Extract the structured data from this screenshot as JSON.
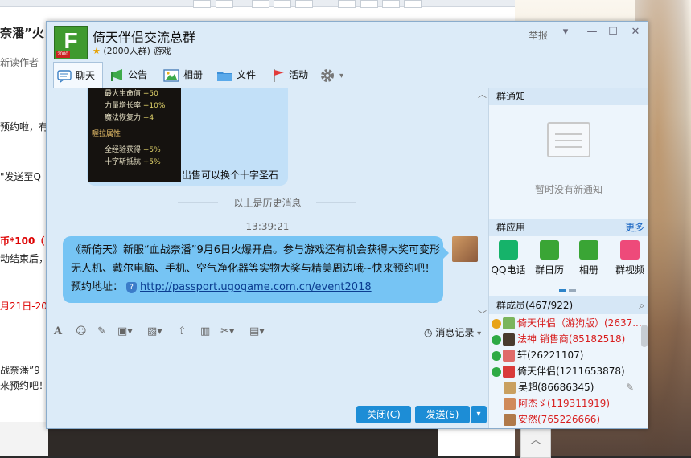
{
  "background": {
    "fragments": [
      "奈潘”火",
      "新读作者",
      "预约啦，有",
      "\"发送至Q",
      "币*100（",
      "动结束后，",
      "月21日-20",
      "战奈潘”9",
      "来预约吧！"
    ]
  },
  "window": {
    "group_name": "倚天伴侣交流总群",
    "group_info": "(2000人群) 游戏",
    "avatar_letter": "F",
    "avatar_sub": "2000",
    "report_label": "举报",
    "tabs": [
      {
        "label": "聊天",
        "icon": "chat-icon"
      },
      {
        "label": "公告",
        "icon": "announcement-icon"
      },
      {
        "label": "相册",
        "icon": "album-icon"
      },
      {
        "label": "文件",
        "icon": "folder-icon"
      },
      {
        "label": "活动",
        "icon": "flag-icon"
      }
    ]
  },
  "chat": {
    "old_image_lines": [
      {
        "name": "最大生命值",
        "value": "+50"
      },
      {
        "name": "力量增长率",
        "value": "+10%"
      },
      {
        "name": "魔法恢复力",
        "value": "+4"
      },
      {
        "name": "喔拉属性",
        "value": ""
      },
      {
        "name": "全经验获得",
        "value": "+5%"
      },
      {
        "name": "十字斩抵抗",
        "value": "+5%"
      }
    ],
    "old_caption": "出售可以换个十字圣石",
    "history_divider": "以上是历史消息",
    "timestamp": "13:39:21",
    "message_text": "《新倚天》新服“血战奈潘”9月6日火爆开启。参与游戏还有机会获得大奖可变形无人机、戴尔电脑、手机、空气净化器等实物大奖与精美周边哦~快来预约吧！预约地址：",
    "message_link": "http://passport.ugogame.com.cn/event2018"
  },
  "toolbar": {
    "history_label": "消息记录",
    "close_label": "关闭(C)",
    "send_label": "发送(S)"
  },
  "sidebar": {
    "notice_title": "群通知",
    "notice_empty": "暂时没有新通知",
    "apps_title": "群应用",
    "more_label": "更多",
    "apps": [
      {
        "label": "QQ电话",
        "color": "#16b36a"
      },
      {
        "label": "群日历",
        "color": "#3aa535"
      },
      {
        "label": "相册",
        "color": "#3aa535"
      },
      {
        "label": "群视频",
        "color": "#ee4a7a"
      }
    ],
    "members_title": "群成员(467/922)",
    "members": [
      {
        "name": "倚天伴侣（游狗版）(2637...",
        "color": "#d81e1e",
        "role": "#e8a317"
      },
      {
        "name": "法神 销售商(85182518)",
        "color": "#d81e1e",
        "role": "#2eaa44"
      },
      {
        "name": "轩(26221107)",
        "color": "#111111",
        "role": "#2eaa44"
      },
      {
        "name": "倚天伴侣(1211653878)",
        "color": "#111111",
        "role": "#2eaa44"
      },
      {
        "name": "吴超(86686345)",
        "color": "#111111",
        "role": ""
      },
      {
        "name": "阿杰ゞ(119311919)",
        "color": "#d81e1e",
        "role": ""
      },
      {
        "name": "安然(765226666)",
        "color": "#d81e1e",
        "role": ""
      }
    ]
  }
}
